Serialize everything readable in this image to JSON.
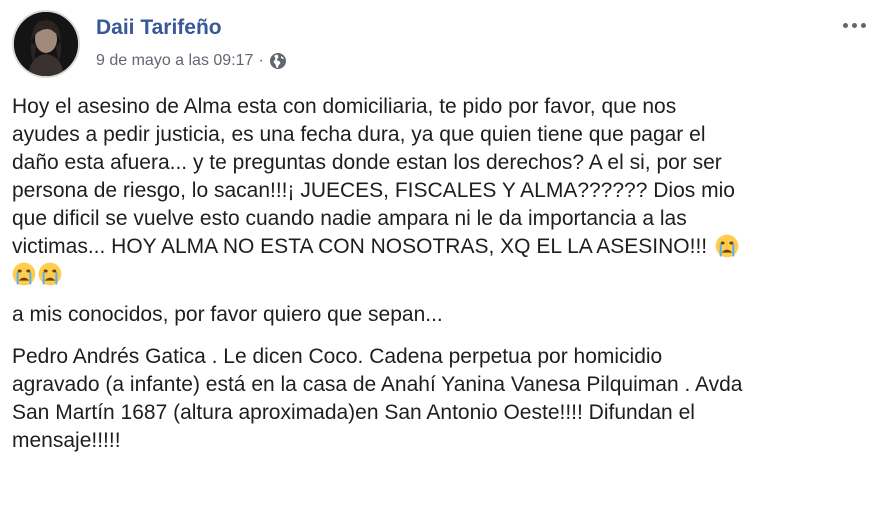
{
  "post": {
    "author": "Daii Tarifeño",
    "timestamp": "9 de mayo a las 09:17",
    "separator": "·",
    "privacy_icon": "globe-icon",
    "more_icon": "more-horizontal-icon",
    "paragraphs": {
      "p1": {
        "lines": [
          "Hoy el asesino de Alma esta con domiciliaria, te pido por favor, que nos",
          "ayudes a pedir justicia, es una fecha dura, ya que quien tiene que pagar el",
          "daño esta afuera... y te preguntas donde estan los derechos? A el si, por ser",
          "persona de riesgo, lo sacan!!!¡ JUECES, FISCALES Y ALMA?????? Dios mio",
          "que dificil se vuelve esto cuando nadie ampara ni le da importancia a las",
          "victimas... HOY ALMA NO ESTA CON NOSOTRAS, XQ EL LA ASESINO!!! "
        ],
        "emoji": "crying-face-emoji"
      },
      "p2": "a mis conocidos, por favor quiero que sepan...",
      "p3": {
        "lines": [
          "Pedro Andrés Gatica . Le dicen Coco. Cadena perpetua por homicidio",
          "agravado (a infante) está en la casa de Anahí Yanina Vanesa Pilquiman . Avda",
          "San Martín 1687 (altura aproximada)en San Antonio Oeste!!!! Difundan el",
          "mensaje!!!!!"
        ]
      }
    }
  },
  "colors": {
    "author": "#385898",
    "meta": "#616770",
    "text": "#1c1e21",
    "emoji_face": "#ffcc4d",
    "emoji_tears": "#5dadec"
  }
}
